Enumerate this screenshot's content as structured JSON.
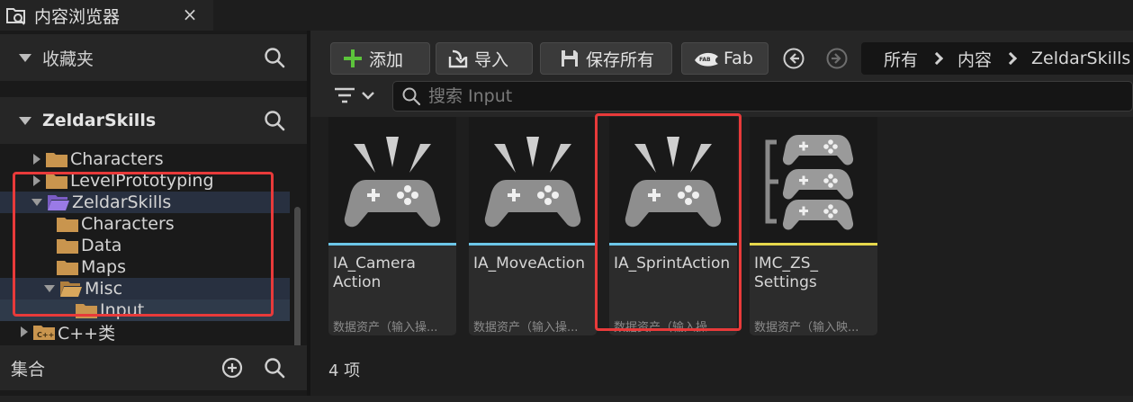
{
  "window": {
    "tab_title": "内容浏览器",
    "close_glyph": "×",
    "icons": {
      "tab": "content-browser-icon",
      "close": "close-icon"
    }
  },
  "sidebar": {
    "favorites": {
      "label": "收藏夹",
      "icon": "search-icon"
    },
    "project": {
      "label": "ZeldarSkills",
      "icon": "search-icon"
    },
    "tree": [
      {
        "label": "Characters",
        "expander": "collapsed",
        "icon": "folder-icon"
      },
      {
        "label": "LevelPrototyping",
        "expander": "collapsed",
        "icon": "folder-icon"
      },
      {
        "label": "ZeldarSkills",
        "expander": "expanded",
        "icon": "folder-open-icon"
      },
      {
        "label": "Characters",
        "expander": "none",
        "icon": "folder-icon"
      },
      {
        "label": "Data",
        "expander": "none",
        "icon": "folder-icon"
      },
      {
        "label": "Maps",
        "expander": "none",
        "icon": "folder-icon"
      },
      {
        "label": "Misc",
        "expander": "expanded",
        "icon": "folder-open-icon"
      },
      {
        "label": "Input",
        "expander": "none",
        "icon": "folder-icon"
      },
      {
        "label": "C++类",
        "expander": "collapsed",
        "icon": "cpp-folder-icon"
      }
    ],
    "collections": {
      "label": "集合",
      "icons": [
        "add-circle-icon",
        "search-icon"
      ]
    }
  },
  "toolbar": {
    "add_label": "添加",
    "import_label": "导入",
    "save_all_label": "保存所有",
    "fab_label": "Fab",
    "icons": [
      "plus-icon",
      "import-icon",
      "save-icon",
      "fab-icon",
      "back-arrow-icon",
      "forward-arrow-icon"
    ]
  },
  "breadcrumb": {
    "items": [
      "所有",
      "内容",
      "ZeldarSkills"
    ]
  },
  "filter": {
    "icon": "filter-icon"
  },
  "search": {
    "placeholder": "搜索 Input",
    "icon": "search-icon"
  },
  "assets": [
    {
      "name_line1": "IA_Camera",
      "name_line2": "Action",
      "type": "数据资产（输入操作）",
      "type_shown": "数据资产（输入操...",
      "icon": "gamepad-icon",
      "bar_color": "#6cc6e8"
    },
    {
      "name_line1": "IA_MoveAction",
      "name_line2": "",
      "type": "数据资产（输入操作）",
      "type_shown": "数据资产（输入操...",
      "icon": "gamepad-icon",
      "bar_color": "#6cc6e8"
    },
    {
      "name_line1": "IA_SprintAction",
      "name_line2": "",
      "type": "数据资产（输入操作）",
      "type_shown": "数据资产（输入操",
      "icon": "gamepad-icon",
      "bar_color": "#6cc6e8"
    },
    {
      "name_line1": "IMC_ZS_",
      "name_line2": "Settings",
      "type": "数据资产（输入映射上下文）",
      "type_shown": "数据资产（输入映...",
      "icon": "input-mapping-context-icon",
      "bar_color": "#e6d84c"
    }
  ],
  "item_count": "4 项",
  "colors": {
    "accent_selection": "#2f3a4a",
    "annotation_red": "#e83a3a",
    "folder": "#c9954e",
    "folder_project": "#8a6ad6",
    "add_plus": "#5cc43b"
  }
}
